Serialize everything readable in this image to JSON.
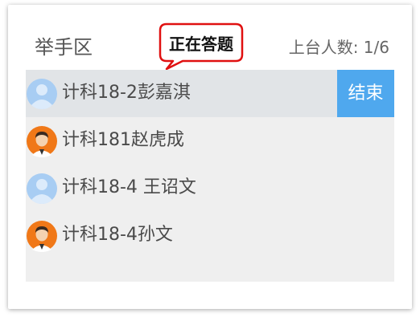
{
  "header": {
    "title": "举手区",
    "bubble_text": "正在答题",
    "counter": "上台人数: 1/6"
  },
  "colors": {
    "accent": "#4fa8ee",
    "list_background": "#efefef",
    "active_row_background": "#e1e4e7",
    "bubble_border": "#e01010"
  },
  "list": {
    "end_label": "结束",
    "items": [
      {
        "name": "计科18-2彭嘉淇",
        "avatar": "default-avatar-icon",
        "active": true
      },
      {
        "name": "计科181赵虎成",
        "avatar": "user-photo-avatar",
        "active": false
      },
      {
        "name": "计科18-4 王诏文",
        "avatar": "default-avatar-icon",
        "active": false
      },
      {
        "name": "计科18-4孙文",
        "avatar": "user-photo-avatar",
        "active": false
      }
    ]
  }
}
